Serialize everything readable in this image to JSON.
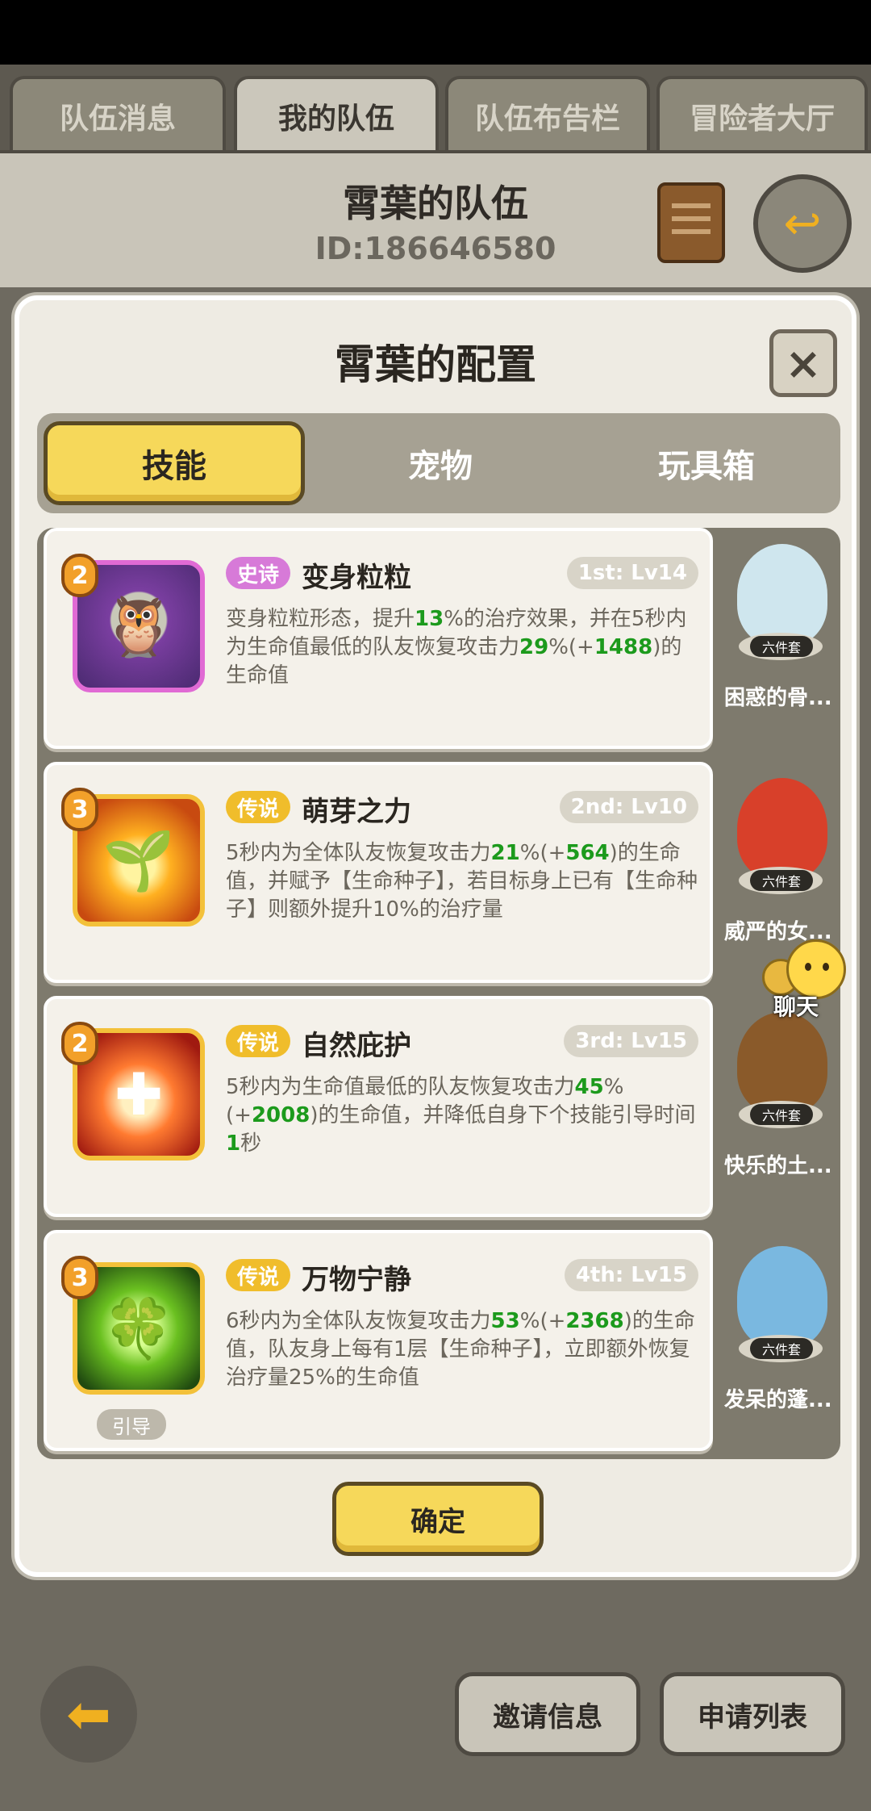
{
  "top_tabs": [
    {
      "label": "队伍消息"
    },
    {
      "label": "我的队伍"
    },
    {
      "label": "队伍布告栏"
    },
    {
      "label": "冒险者大厅"
    }
  ],
  "team": {
    "name": "霄葉的队伍",
    "id": "ID:186646580"
  },
  "dialog": {
    "title": "霄葉的配置",
    "close_label": "×",
    "tabs": [
      {
        "label": "技能"
      },
      {
        "label": "宠物"
      },
      {
        "label": "玩具箱"
      }
    ],
    "confirm_label": "确定"
  },
  "skills": [
    {
      "level": "2",
      "rarity": "史诗",
      "name": "变身粒粒",
      "rank": "1st: Lv14",
      "desc": [
        {
          "t": "变身粒粒形态，提升"
        },
        {
          "t": "13",
          "g": true
        },
        {
          "t": "%的治疗效果，并在5秒内为生命值最低的队友恢复攻击力"
        },
        {
          "t": "29",
          "g": true
        },
        {
          "t": "%(+"
        },
        {
          "t": "1488",
          "g": true
        },
        {
          "t": ")的生命值"
        }
      ]
    },
    {
      "level": "3",
      "rarity": "传说",
      "name": "萌芽之力",
      "rank": "2nd: Lv10",
      "desc": [
        {
          "t": "5秒内为全体队友恢复攻击力"
        },
        {
          "t": "21",
          "g": true
        },
        {
          "t": "%(+"
        },
        {
          "t": "564",
          "g": true
        },
        {
          "t": ")的生命值，并赋予【生命种子】，若目标身上已有【生命种子】则额外提升10%的治疗量"
        }
      ]
    },
    {
      "level": "2",
      "rarity": "传说",
      "name": "自然庇护",
      "rank": "3rd: Lv15",
      "desc": [
        {
          "t": "5秒内为生命值最低的队友恢复攻击力"
        },
        {
          "t": "45",
          "g": true
        },
        {
          "t": "%(+"
        },
        {
          "t": "2008",
          "g": true
        },
        {
          "t": ")的生命值，并降低自身下个技能引导时间"
        },
        {
          "t": "1",
          "g": true
        },
        {
          "t": "秒"
        }
      ]
    },
    {
      "level": "3",
      "rarity": "传说",
      "name": "万物宁静",
      "rank": "4th: Lv15",
      "chip": "引导",
      "desc": [
        {
          "t": "6秒内为全体队友恢复攻击力"
        },
        {
          "t": "53",
          "g": true
        },
        {
          "t": "%(+"
        },
        {
          "t": "2368",
          "g": true
        },
        {
          "t": ")的生命值，队友身上每有1层【生命种子】，立即额外恢复治疗量25%的生命值"
        }
      ]
    }
  ],
  "pets": [
    {
      "name": "困惑的骨...",
      "tag": "六件套",
      "color": "#cfe6ee"
    },
    {
      "name": "威严的女...",
      "tag": "六件套",
      "color": "#d8402a"
    },
    {
      "name": "快乐的土...",
      "tag": "六件套",
      "color": "#8a5a2a"
    },
    {
      "name": "发呆的蓬...",
      "tag": "六件套",
      "color": "#7ab8e0"
    }
  ],
  "chat": {
    "label": "聊天"
  },
  "bottom": {
    "invite_label": "邀请信息",
    "apply_label": "申请列表"
  },
  "icons": [
    "scroll-icon",
    "return-icon",
    "close-icon",
    "chat-icon",
    "back-arrow-icon"
  ]
}
